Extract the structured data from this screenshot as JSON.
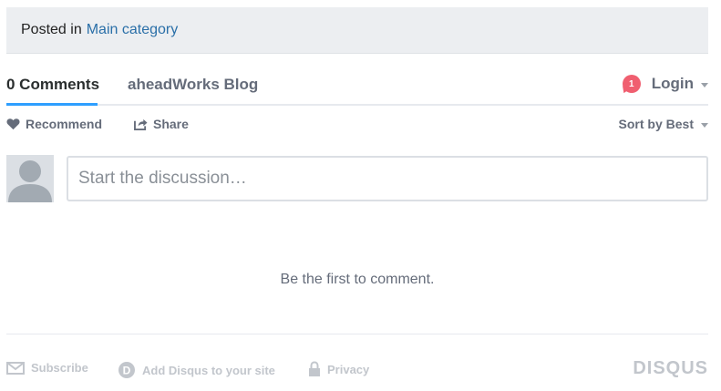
{
  "posted": {
    "prefix": "Posted in",
    "category": "Main category"
  },
  "tabs": {
    "comments": "0 Comments",
    "forum": "aheadWorks Blog",
    "login": "Login",
    "notification_count": "1"
  },
  "actions": {
    "recommend": "Recommend",
    "share": "Share",
    "sort": "Sort by Best"
  },
  "composer": {
    "placeholder": "Start the discussion…"
  },
  "empty_message": "Be the first to comment.",
  "footer": {
    "subscribe": "Subscribe",
    "add_disqus": "Add Disqus to your site",
    "privacy": "Privacy",
    "logo": "DISQUS"
  },
  "colors": {
    "accent_blue": "#2e9fff",
    "link": "#2a6fa8",
    "badge": "#f05f70",
    "muted": "#656c7a"
  }
}
